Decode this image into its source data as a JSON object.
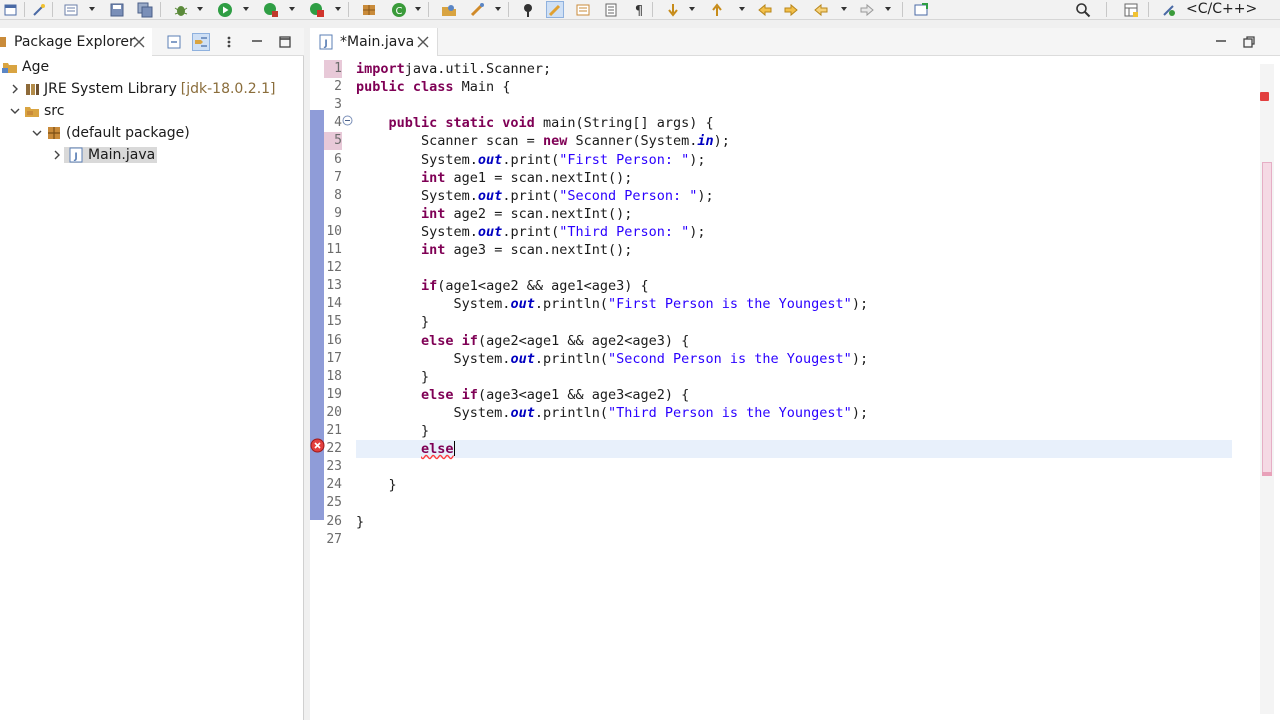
{
  "toolbar": {
    "perspective_label": "<C/C++>",
    "icons": [
      "new-icon",
      "save-icon",
      "save-all-icon",
      "debug-icon",
      "run-icon",
      "coverage-icon",
      "external-tools-icon",
      "new-package-icon",
      "new-class-icon",
      "open-type-icon",
      "search-icon-toolbar",
      "annotation-icon",
      "highlight-icon",
      "toggle-breadcrumb-icon",
      "show-whitespace-icon",
      "next-annotation-icon",
      "previous-annotation-icon",
      "last-edit-icon",
      "back-icon",
      "forward-icon",
      "open-perspective-icon",
      "quick-access-search-icon"
    ]
  },
  "left": {
    "tab_label": "Package Explorer",
    "tree": [
      {
        "label": "Age",
        "extra": "",
        "icon": "project-icon",
        "expanded": true
      },
      {
        "label": "JRE System Library",
        "extra": "[jdk-18.0.2.1]",
        "icon": "library-icon",
        "expanded": false
      },
      {
        "label": "src",
        "extra": "",
        "icon": "source-folder-icon",
        "expanded": true
      },
      {
        "label": "(default package)",
        "extra": "",
        "icon": "package-icon",
        "expanded": true
      },
      {
        "label": "Main.java",
        "extra": "",
        "icon": "java-file-icon",
        "expanded": false
      }
    ]
  },
  "editor": {
    "tab_label": "*Main.java",
    "current_line": 22,
    "error_line": 22,
    "lines": [
      {
        "n": "1"
      },
      {
        "n": "2"
      },
      {
        "n": "3"
      },
      {
        "n": "4"
      },
      {
        "n": "5"
      },
      {
        "n": "6"
      },
      {
        "n": "7"
      },
      {
        "n": "8"
      },
      {
        "n": "9"
      },
      {
        "n": "10"
      },
      {
        "n": "11"
      },
      {
        "n": "12"
      },
      {
        "n": "13"
      },
      {
        "n": "14"
      },
      {
        "n": "15"
      },
      {
        "n": "16"
      },
      {
        "n": "17"
      },
      {
        "n": "18"
      },
      {
        "n": "19"
      },
      {
        "n": "20"
      },
      {
        "n": "21"
      },
      {
        "n": "22"
      },
      {
        "n": "23"
      },
      {
        "n": "24"
      },
      {
        "n": "25"
      },
      {
        "n": "26"
      },
      {
        "n": "27"
      }
    ],
    "code": [
      [
        [
          "kw",
          "import"
        ],
        [
          "",
          "java.util.Scanner;"
        ]
      ],
      [
        [
          "kw",
          "public class"
        ],
        [
          "",
          " Main {"
        ]
      ],
      [],
      [
        [
          "",
          "    "
        ],
        [
          "kw",
          "public static void"
        ],
        [
          "",
          " main(String[] args) {"
        ]
      ],
      [
        [
          "",
          "        Scanner scan = "
        ],
        [
          "kw",
          "new"
        ],
        [
          "",
          " Scanner(System."
        ],
        [
          "fld",
          "in"
        ],
        [
          "",
          ");"
        ]
      ],
      [
        [
          "",
          "        System."
        ],
        [
          "fld",
          "out"
        ],
        [
          "",
          ".print("
        ],
        [
          "str",
          "\"First Person: \""
        ],
        [
          "",
          ");"
        ]
      ],
      [
        [
          "",
          "        "
        ],
        [
          "kw",
          "int"
        ],
        [
          "",
          " age1 = scan.nextInt();"
        ]
      ],
      [
        [
          "",
          "        System."
        ],
        [
          "fld",
          "out"
        ],
        [
          "",
          ".print("
        ],
        [
          "str",
          "\"Second Person: \""
        ],
        [
          "",
          ");"
        ]
      ],
      [
        [
          "",
          "        "
        ],
        [
          "kw",
          "int"
        ],
        [
          "",
          " age2 = scan.nextInt();"
        ]
      ],
      [
        [
          "",
          "        System."
        ],
        [
          "fld",
          "out"
        ],
        [
          "",
          ".print("
        ],
        [
          "str",
          "\"Third Person: \""
        ],
        [
          "",
          ");"
        ]
      ],
      [
        [
          "",
          "        "
        ],
        [
          "kw",
          "int"
        ],
        [
          "",
          " age3 = scan.nextInt();"
        ]
      ],
      [],
      [
        [
          "",
          "        "
        ],
        [
          "kw",
          "if"
        ],
        [
          "",
          "(age1<age2 && age1<age3) {"
        ]
      ],
      [
        [
          "",
          "            System."
        ],
        [
          "fld",
          "out"
        ],
        [
          "",
          ".println("
        ],
        [
          "str",
          "\"First Person is the Youngest\""
        ],
        [
          "",
          ");"
        ]
      ],
      [
        [
          "",
          "        }"
        ]
      ],
      [
        [
          "",
          "        "
        ],
        [
          "kw",
          "else if"
        ],
        [
          "",
          "(age2<age1 && age2<age3) {"
        ]
      ],
      [
        [
          "",
          "            System."
        ],
        [
          "fld",
          "out"
        ],
        [
          "",
          ".println("
        ],
        [
          "str",
          "\"Second Person is the Yougest\""
        ],
        [
          "",
          ");"
        ]
      ],
      [
        [
          "",
          "        }"
        ]
      ],
      [
        [
          "",
          "        "
        ],
        [
          "kw",
          "else if"
        ],
        [
          "",
          "(age3<age1 && age3<age2) {"
        ]
      ],
      [
        [
          "",
          "            System."
        ],
        [
          "fld",
          "out"
        ],
        [
          "",
          ".println("
        ],
        [
          "str",
          "\"Third Person is the Youngest\""
        ],
        [
          "",
          ");"
        ]
      ],
      [
        [
          "",
          "        }"
        ]
      ],
      [
        [
          "",
          "        "
        ],
        [
          "kwerr",
          "else"
        ]
      ],
      [],
      [
        [
          "",
          "    }"
        ]
      ],
      [],
      [
        [
          "",
          "}"
        ]
      ],
      []
    ]
  },
  "colors": {
    "keyword": "#7f0055",
    "string": "#2a00ff",
    "field": "#0000c0",
    "current_line": "#e8f0fb",
    "gutter_bar": "#8f9cd8",
    "error": "#e23f3f"
  }
}
